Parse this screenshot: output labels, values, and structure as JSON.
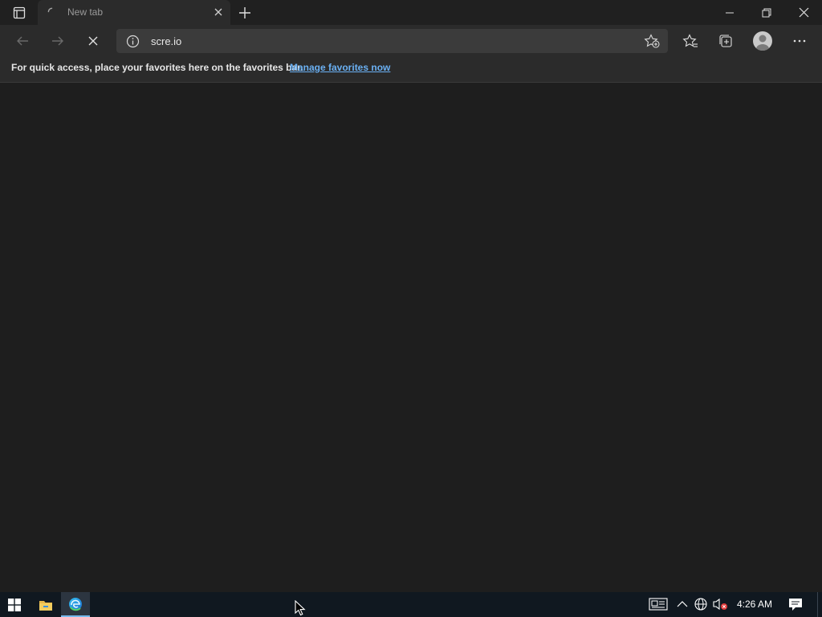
{
  "tab": {
    "title": "New tab"
  },
  "omnibox": {
    "url": "scre.io"
  },
  "favorites_bar": {
    "message": "For quick access, place your favorites here on the favorites bar.",
    "link_label": "Manage favorites now"
  },
  "taskbar": {
    "clock": "4:26 AM"
  },
  "colors": {
    "accent": "#6ab0f3",
    "taskbar_active": "#76b9ed"
  },
  "icons": [
    "tab-actions-icon",
    "loading-spinner-icon",
    "close-icon",
    "plus-icon",
    "minimize-icon",
    "restore-icon",
    "back-arrow-icon",
    "forward-arrow-icon",
    "stop-icon",
    "info-icon",
    "add-favorite-icon",
    "favorites-icon",
    "collections-icon",
    "profile-icon",
    "more-icon",
    "windows-logo-icon",
    "file-explorer-icon",
    "edge-icon",
    "news-icon",
    "chevron-up-icon",
    "globe-icon",
    "speaker-muted-icon",
    "notification-icon",
    "cursor-icon"
  ]
}
